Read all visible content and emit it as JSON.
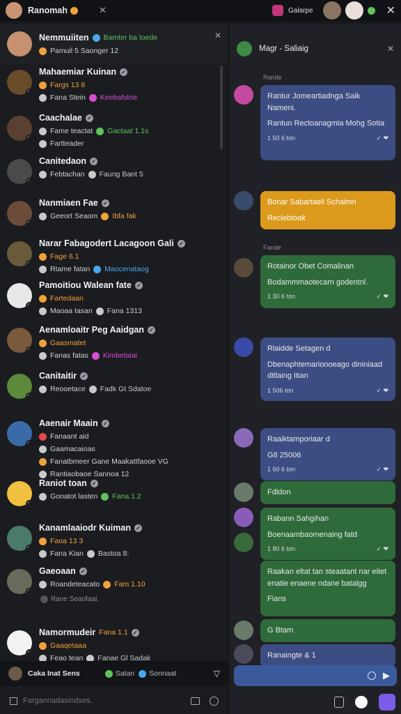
{
  "topbar": {
    "title": "Ranomah",
    "right_label": "Galarpe"
  },
  "left_header": {
    "name": "Nemmuiiten",
    "tag": "Bamter ba toede",
    "sub": "Pamuil 5 Saonger 12"
  },
  "contacts": [
    {
      "name": "Mahaemiar Kuinan",
      "line1": "Fargs 13 8",
      "line2a": "Fana Stein",
      "line2b": "Keebafstrie",
      "c1": "#f0a23a",
      "c2": "#d64fd1",
      "bg": "#6a4b2a"
    },
    {
      "name": "Caachalae",
      "line1": "Fame teactat",
      "line1b": "Gactaal 1.1s",
      "line2a": "Fartteader",
      "c1": "#c9c9c9",
      "c2": "#5fc25a",
      "bg": "#5a4030"
    },
    {
      "name": "Canitedaon",
      "line1": "Febtachan",
      "line1b": "Faung Bant 5",
      "c1": "#c9c9c9",
      "c2": "#c9c9c9",
      "bg": "#4a4a4a"
    },
    {
      "name": "Nanmiaen Fae",
      "line1": "Geeort Seaom",
      "line1b": "Ibfa fak",
      "c1": "#c9c9c9",
      "c2": "#f0a23a",
      "bg": "#6b4b3a"
    },
    {
      "name": "Narar Fabagodert Lacagoon Gali",
      "line1": "Fage 6.1",
      "line2a": "Rtame fatan",
      "line2b": "Maocenataog",
      "c1": "#f0a23a",
      "c2": "#4aa8e8",
      "bg": "#6a5a3a"
    },
    {
      "name": "Pamoitiou Walean fate",
      "line1": "Fartedaan",
      "line2a": "Maoaa tasan",
      "line2b": "Fana 1313",
      "c1": "#f0a23a",
      "c2": "#c9c9c9",
      "bg": "#e8e8e8"
    },
    {
      "name": "Aenamloaitr Peg Aaidgan",
      "line1": "Gaasmatet",
      "line2a": "Fanas fatas",
      "line2b": "Kimbetaiai",
      "c1": "#f0a23a",
      "c2": "#d64fd1",
      "bg": "#7a5a3a"
    },
    {
      "name": "Canitaitir",
      "line1": "Reooetace",
      "line1b": "Fadk Gt Sdatoe",
      "c1": "#c9c9c9",
      "c2": "#c9c9c9",
      "bg": "#5a8a3a"
    },
    {
      "name": "Aaenair Maain",
      "line1": "Fanaant aid",
      "line2a": "Gaamacaioas",
      "line3": "Fanatbmeer Gane Maakattfaooe VG",
      "line4": "Rantiaobaoe Sannoa 12",
      "c1": "#e24a4a",
      "c2": "#f0a23a",
      "bg": "#3a6aa8"
    },
    {
      "name": "Raniot toan",
      "line1": "Gonatot lasten",
      "line1b": "Fana 1.2",
      "c1": "#c9c9c9",
      "c2": "#5fc25a",
      "bg": "#f0c040"
    },
    {
      "name": "Kanamlaaiodr Kuiman",
      "line1": "Faoa 13 3",
      "line2a": "Fana Kian",
      "line2b": "Bastoa 8:",
      "c1": "#f0a23a",
      "c2": "#c9c9c9",
      "bg": "#4a7a6a"
    },
    {
      "name": "Gaeoaan",
      "line1": "Roandeteacato",
      "line1b": "Fam 1.10",
      "c1": "#c9c9c9",
      "c2": "#f0a23a",
      "bg": "#6a6a5a"
    },
    {
      "name": "Namormudeir",
      "tag": "Fana 1.1",
      "line1": "Gaaqetaaa",
      "line2a": "Feao tean",
      "line2b": "Fanae Gl Sadak",
      "c1": "#f0a23a",
      "c2": "#c9c9c9",
      "bg": "#f2f2f2"
    }
  ],
  "divider_label": "Rane Seaofaal.",
  "bottom_status": {
    "name": "Caka Inat Sens",
    "a": "Satan",
    "b": "Sonnaat"
  },
  "left_input": {
    "placeholder": "Fargannadasindses."
  },
  "right_header": {
    "title": "Magr - Saliaig"
  },
  "day_labels": [
    "Rande",
    "Fande"
  ],
  "messages": [
    {
      "id": "m1",
      "text1": "Rantur Jomeartiadnga Saik Nameni.",
      "text2": "Rantun Rectoanagmia Mohg Sotia",
      "time": "1 50 6 ton"
    },
    {
      "id": "m2",
      "text1": "Bonar Sabartaeli Schaimn",
      "text2": "Reciebtoak",
      "time": ""
    },
    {
      "id": "m3",
      "text1": "Rotainor Obet Comalinan",
      "text2": "Bodammmaotecarn godentnl.",
      "time": "1 30 6 ton"
    },
    {
      "id": "m4",
      "text1": "Rlaidde Setagen d",
      "text2": "Dbenaphtemarionoeago dininiaad ditlaing Itian",
      "time": "1 506 ton"
    },
    {
      "id": "m5",
      "text1": "Raaiktamporiaar d",
      "text2": "G8 25006",
      "time": "1 60 6 ton"
    },
    {
      "id": "m6",
      "text1": "Fdldon",
      "text2": "",
      "time": ""
    },
    {
      "id": "m7",
      "text1": "Rabann Sahgihan",
      "text2": "Boenaambaomenaing fatd",
      "time": "1 80 6 ton"
    },
    {
      "id": "m8",
      "text1": "Raakan eltat tan steaatant nar eitet enatie enaene ndane batalgg",
      "text2": "Fians",
      "time": ""
    },
    {
      "id": "m9",
      "text1": "G Btam",
      "text2": "",
      "time": ""
    },
    {
      "id": "m10",
      "text1": "Ranaingte & 1",
      "text2": "",
      "time": ""
    }
  ],
  "colors": {
    "blue": "#3b4d82",
    "orange": "#dc9a1c",
    "green": "#2f6b3a",
    "accent": "#7b5ce8"
  }
}
